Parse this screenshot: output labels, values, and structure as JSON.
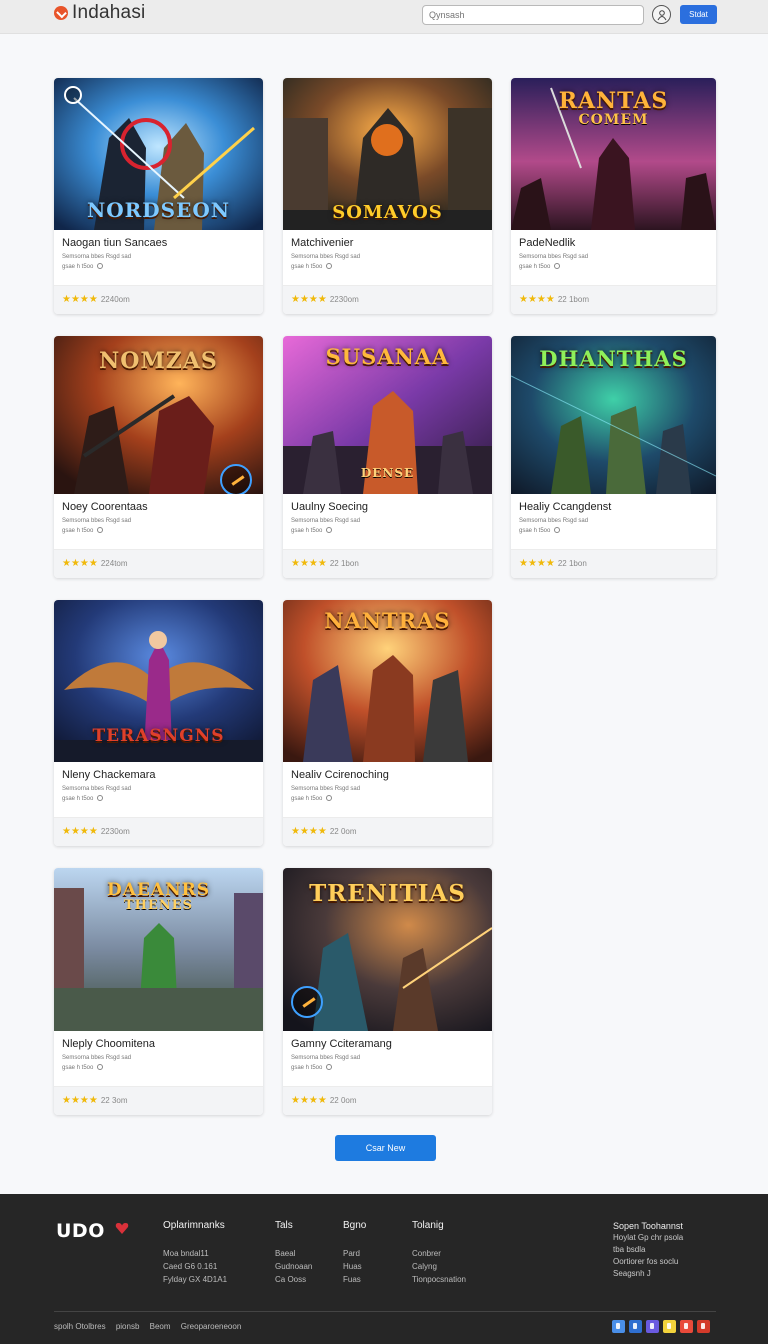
{
  "header": {
    "brand": "Indahasi",
    "search_placeholder": "Qynsash",
    "signin_label": "Stdat"
  },
  "cards": [
    {
      "art_title": "NORDSEON",
      "art_subtitle": "",
      "title": "Naogan tiun Sancaes",
      "meta": "Semsorna bbes Rsgd sad",
      "meta2": "gsae h t5oo",
      "rating": "2240om",
      "stars": "★★★★"
    },
    {
      "art_title": "SOMAVOS",
      "art_subtitle": "",
      "title": "Matchivenier",
      "meta": "Semsorna bbes Rsgd sad",
      "meta2": "gsae h t5oo",
      "rating": "2230om",
      "stars": "★★★★"
    },
    {
      "art_title": "RANTAS",
      "art_subtitle": "COMEM",
      "title": "PadeNedlik",
      "meta": "Semsorna bbes Rsgd sad",
      "meta2": "gsae h t5oo",
      "rating": "22 1bom",
      "stars": "★★★★"
    },
    {
      "art_title": "NOMZAS",
      "art_subtitle": "",
      "title": "Noey Coorentaas",
      "meta": "Semsorna bbes Rsgd sad",
      "meta2": "gsae h t5oo",
      "rating": "224tom",
      "stars": "★★★★"
    },
    {
      "art_title": "SUSANAA",
      "art_subtitle": "DENSE",
      "title": "Uaulny Soecing",
      "meta": "Semsorna bbes Rsgd sad",
      "meta2": "gsae h t5oo",
      "rating": "22 1bon",
      "stars": "★★★★"
    },
    {
      "art_title": "DHANTHAS",
      "art_subtitle": "",
      "title": "Healiy Ccangdenst",
      "meta": "Semsorna bbes Rsgd sad",
      "meta2": "gsae h t5oo",
      "rating": "22 1bon",
      "stars": "★★★★"
    },
    {
      "art_title": "TERASNGNS",
      "art_subtitle": "",
      "title": "Nleny Chackemara",
      "meta": "Semsorna bbes Rsgd sad",
      "meta2": "gsae h t5oo",
      "rating": "2230om",
      "stars": "★★★★"
    },
    {
      "art_title": "NANTRAS",
      "art_subtitle": "",
      "title": "Nealiv Ccirenoching",
      "meta": "Semsorna bbes Rsgd sad",
      "meta2": "gsae h t5oo",
      "rating": "22 0om",
      "stars": "★★★★"
    },
    {
      "art_title": "DAEANRS",
      "art_subtitle": "THENES",
      "title": "Nleply Choomitena",
      "meta": "Semsorna bbes Rsgd sad",
      "meta2": "gsae h t5oo",
      "rating": "22 3om",
      "stars": "★★★★"
    },
    {
      "art_title": "TRENITIAS",
      "art_subtitle": "",
      "title": "Gamny Cciteramang",
      "meta": "Semsorna bbes Rsgd sad",
      "meta2": "gsae h t5oo",
      "rating": "22 0om",
      "stars": "★★★★"
    }
  ],
  "load_more_label": "Csar New",
  "footer": {
    "logo": "UDO",
    "columns": [
      {
        "heading": "Oplarimnanks",
        "links": [
          "Moa bndal11",
          "Caed G6 0.161",
          "Fylday GX 4D1A1"
        ]
      },
      {
        "heading": "Tals",
        "links": [
          "Baeal",
          "Gudnoaan",
          "Ca Ooss"
        ]
      },
      {
        "heading": "Bgno",
        "links": [
          "Pard",
          "Huas",
          "Fuas"
        ]
      },
      {
        "heading": "Tolanig",
        "links": [
          "Conbrer",
          "Calyng",
          "Tionpocsnation"
        ]
      }
    ],
    "right_lines": [
      "Sopen Toohannst",
      "Hoylat Gp chr psola",
      "tba bsdla",
      "Oortiorer fos soclu",
      "Seagsnh J"
    ],
    "bottom_items": [
      "spolh Otolbres",
      "pionsb",
      "Beom",
      "Greoparoeneoon"
    ],
    "social_colors": [
      "#4a8fe8",
      "#2f6fd0",
      "#6a5ae0",
      "#f2d33c",
      "#e94a3a",
      "#d33a2a"
    ]
  }
}
